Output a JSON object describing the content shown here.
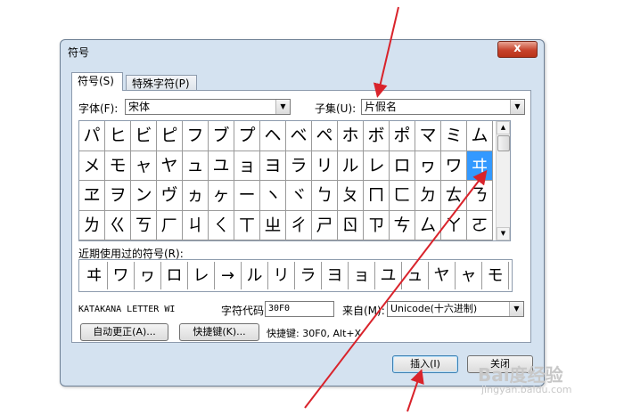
{
  "window": {
    "title": "符号",
    "close_glyph": "x"
  },
  "tabs": [
    {
      "label": "符号(S)",
      "active": true
    },
    {
      "label": "特殊字符(P)",
      "active": false
    }
  ],
  "font": {
    "label": "字体(F):",
    "value": "宋体"
  },
  "subset": {
    "label": "子集(U):",
    "value": "片假名"
  },
  "symbol_grid": [
    [
      "パ",
      "ヒ",
      "ビ",
      "ピ",
      "フ",
      "ブ",
      "プ",
      "ヘ",
      "ベ",
      "ペ",
      "ホ",
      "ボ",
      "ポ",
      "マ",
      "ミ",
      "ム"
    ],
    [
      "メ",
      "モ",
      "ャ",
      "ヤ",
      "ュ",
      "ユ",
      "ョ",
      "ヨ",
      "ラ",
      "リ",
      "ル",
      "レ",
      "ロ",
      "ヮ",
      "ワ",
      "ヰ"
    ],
    [
      "ヱ",
      "ヲ",
      "ン",
      "ヴ",
      "ヵ",
      "ヶ",
      "ー",
      "ヽ",
      "ヾ",
      "ㄅ",
      "ㄆ",
      "ㄇ",
      "ㄈ",
      "ㄉ",
      "ㄊ",
      "ㄋ"
    ],
    [
      "ㄌ",
      "ㄍ",
      "ㄎ",
      "ㄏ",
      "ㄐ",
      "ㄑ",
      "ㄒ",
      "ㄓ",
      "ㄔ",
      "ㄕ",
      "ㄖ",
      "ㄗ",
      "ㄘ",
      "ㄙ",
      "ㄚ",
      "ㄛ"
    ]
  ],
  "selected_symbol": "ヰ",
  "recent": {
    "label": "近期使用过的符号(R):",
    "symbols": [
      "ヰ",
      "ワ",
      "ヮ",
      "ロ",
      "レ",
      "→",
      "ル",
      "リ",
      "ラ",
      "ヨ",
      "ョ",
      "ユ",
      "ュ",
      "ヤ",
      "ャ",
      "モ"
    ]
  },
  "char_name": "KATAKANA LETTER WI",
  "char_code": {
    "label": "字符代码(C):",
    "value": "30F0"
  },
  "from": {
    "label": "来自(M):",
    "value": "Unicode(十六进制)"
  },
  "buttons": {
    "autocorrect": "自动更正(A)...",
    "shortcut_key": "快捷键(K)...",
    "insert": "插入(I)",
    "close": "关闭"
  },
  "shortcut_info": "快捷键: 30F0, Alt+X",
  "watermark": {
    "main": "Bai度经验",
    "sub": "jingyan.baidu.com"
  },
  "colors": {
    "selection": "#3399ff",
    "annotation_arrow": "#d9232b",
    "dialog_bg": "#d4e2f0"
  }
}
